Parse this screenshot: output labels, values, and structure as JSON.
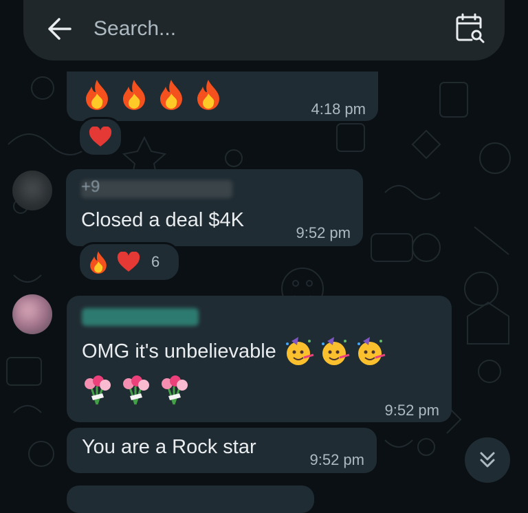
{
  "search": {
    "placeholder": "Search..."
  },
  "icons": {
    "back": "arrow-left-icon",
    "calendar_search": "calendar-search-icon",
    "scroll_down": "double-chevron-down-icon",
    "flame": "fire-emoji",
    "heart": "red-heart-emoji",
    "party_face": "partying-face-emoji",
    "tulips": "bouquet-emoji"
  },
  "colors": {
    "background": "#0b1014",
    "bubble": "#202c33",
    "text": "#e9edef",
    "muted": "#aebac1",
    "sender_teal": "#3bb6a4"
  },
  "messages": [
    {
      "id": "m1",
      "content": "🔥🔥🔥🔥",
      "time": "4:18 pm",
      "reactions": [
        {
          "emoji": "❤️"
        }
      ]
    },
    {
      "id": "m2",
      "sender": "+9",
      "text": "Closed a deal $4K",
      "time": "9:52 pm",
      "reactions": [
        {
          "emoji": "🔥"
        },
        {
          "emoji": "❤️"
        }
      ],
      "reaction_count": "6"
    },
    {
      "id": "m3",
      "text": "OMG it's unbelievable",
      "time": "9:52 pm"
    },
    {
      "id": "m4",
      "text": "You are a Rock star",
      "time": "9:52 pm"
    }
  ]
}
